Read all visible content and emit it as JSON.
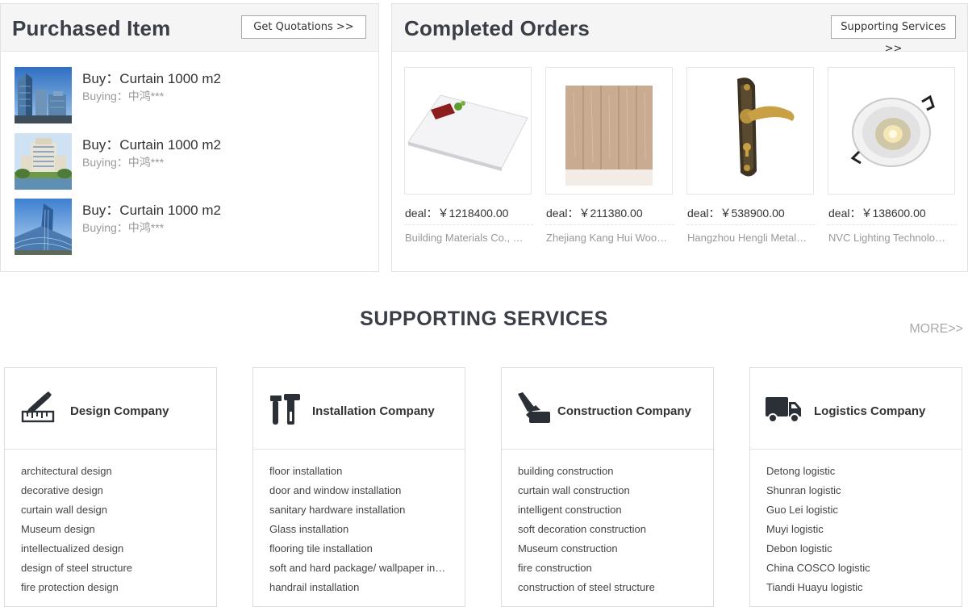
{
  "purchased": {
    "title": "Purchased Item",
    "button": "Get Quotations >>",
    "items": [
      {
        "title": "Buy：Curtain 1000 m2",
        "buyer": "Buying：中鸿***"
      },
      {
        "title": "Buy：Curtain 1000 m2",
        "buyer": "Buying：中鸿***"
      },
      {
        "title": "Buy：Curtain 1000 m2",
        "buyer": "Buying：中鸿***"
      }
    ]
  },
  "completed": {
    "title": "Completed Orders",
    "button": "Supporting Services >>",
    "orders": [
      {
        "deal": "deal：￥1218400.00",
        "company": "Building Materials Co., Ltd."
      },
      {
        "deal": "deal：￥211380.00",
        "company": "Zhejiang Kang Hui Wood Co., Ltd."
      },
      {
        "deal": "deal：￥538900.00",
        "company": "Hangzhou Hengli Metal Products"
      },
      {
        "deal": "deal：￥138600.00",
        "company": "NVC Lighting Technology Co., Ltd."
      }
    ]
  },
  "services": {
    "title": "SUPPORTING SERVICES",
    "more": "MORE>>",
    "cards": [
      {
        "title": "Design Company",
        "icon": "ruler-pencil-icon",
        "items": [
          "architectural design",
          "decorative design",
          "curtain wall design",
          "Museum design",
          "intellectualized design",
          "design of steel structure",
          "fire protection design"
        ]
      },
      {
        "title": "Installation Company",
        "icon": "tools-icon",
        "items": [
          "floor installation",
          "door and window installation",
          "sanitary hardware installation",
          "Glass installation",
          "flooring tile installation",
          "soft and hard package/ wallpaper installation",
          "handrail installation"
        ]
      },
      {
        "title": "Construction Company",
        "icon": "trowel-icon",
        "items": [
          "building construction",
          "curtain wall construction",
          "intelligent construction",
          "soft decoration construction",
          "Museum construction",
          "fire construction",
          "construction of steel structure"
        ]
      },
      {
        "title": "Logistics Company",
        "icon": "truck-icon",
        "items": [
          "Detong logistic",
          "Shunran logistic",
          "Guo Lei logistic",
          "Muyi logistic",
          "Debon logistic",
          "China COSCO logistic",
          "Tiandi Huayu logistic"
        ]
      }
    ]
  }
}
